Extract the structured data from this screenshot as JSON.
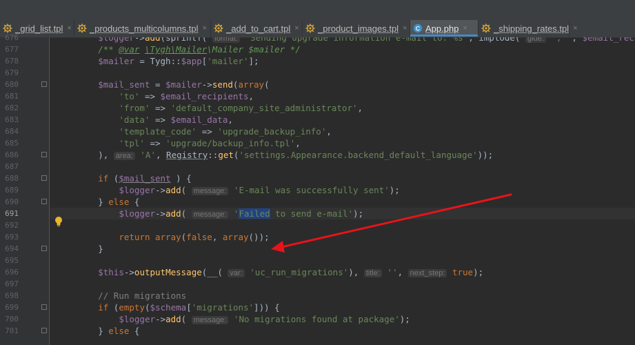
{
  "tabs": [
    {
      "label": "_grid_list.tpl",
      "icon": "smarty-template-icon",
      "active": false
    },
    {
      "label": "_products_multicolumns.tpl",
      "icon": "smarty-template-icon",
      "active": false
    },
    {
      "label": "_add_to_cart.tpl",
      "icon": "smarty-template-icon",
      "active": false
    },
    {
      "label": "_product_images.tpl",
      "icon": "smarty-template-icon",
      "active": false
    },
    {
      "label": "App.php",
      "icon": "php-class-icon",
      "active": true
    },
    {
      "label": "_shipping_rates.tpl",
      "icon": "smarty-template-icon",
      "active": false
    }
  ],
  "close_glyph": "×",
  "current_line": "691",
  "lines": [
    {
      "num": "676",
      "segments": [
        [
          "",
          "        "
        ],
        [
          "v",
          "$logger"
        ],
        [
          "",
          "->"
        ],
        [
          "f",
          "add"
        ],
        [
          "",
          "(sprintf( "
        ],
        [
          "hint",
          "format:"
        ],
        [
          "s",
          " 'Sending upgrade information e-mail to: %s'"
        ],
        [
          "",
          ", implode( "
        ],
        [
          "hint",
          "glue:"
        ],
        [
          "s",
          " ', '"
        ],
        [
          "",
          ", "
        ],
        [
          "v",
          "$email_recipients"
        ]
      ]
    },
    {
      "num": "677",
      "segments": [
        [
          "",
          "        "
        ],
        [
          "c",
          "/** "
        ],
        [
          "c u",
          "@var"
        ],
        [
          "c",
          " "
        ],
        [
          "c u",
          "\\Tygh\\Mailer"
        ],
        [
          "c",
          "\\Mailer "
        ],
        [
          "c",
          "$mailer"
        ],
        [
          "c",
          " */"
        ]
      ]
    },
    {
      "num": "678",
      "segments": [
        [
          "",
          "        "
        ],
        [
          "v",
          "$mailer"
        ],
        [
          "",
          " = Tygh::"
        ],
        [
          "v",
          "$app"
        ],
        [
          "",
          "["
        ],
        [
          "s",
          "'mailer'"
        ],
        [
          "",
          "];"
        ]
      ]
    },
    {
      "num": "679",
      "segments": []
    },
    {
      "num": "680",
      "segments": [
        [
          "",
          "        "
        ],
        [
          "v",
          "$mail_sent"
        ],
        [
          "",
          " = "
        ],
        [
          "v",
          "$mailer"
        ],
        [
          "",
          "->"
        ],
        [
          "f",
          "send"
        ],
        [
          "",
          "("
        ],
        [
          "k",
          "array"
        ],
        [
          "",
          "("
        ]
      ]
    },
    {
      "num": "681",
      "segments": [
        [
          "",
          "            "
        ],
        [
          "s",
          "'to'"
        ],
        [
          "",
          " => "
        ],
        [
          "v",
          "$email_recipients"
        ],
        [
          "",
          ","
        ]
      ]
    },
    {
      "num": "682",
      "segments": [
        [
          "",
          "            "
        ],
        [
          "s",
          "'from'"
        ],
        [
          "",
          " => "
        ],
        [
          "s",
          "'default_company_site_administrator'"
        ],
        [
          "",
          ","
        ]
      ]
    },
    {
      "num": "683",
      "segments": [
        [
          "",
          "            "
        ],
        [
          "s",
          "'data'"
        ],
        [
          "",
          " => "
        ],
        [
          "v",
          "$email_data"
        ],
        [
          "",
          ","
        ]
      ]
    },
    {
      "num": "684",
      "segments": [
        [
          "",
          "            "
        ],
        [
          "s",
          "'template_code'"
        ],
        [
          "",
          " => "
        ],
        [
          "s",
          "'upgrade_backup_info'"
        ],
        [
          "",
          ","
        ]
      ]
    },
    {
      "num": "685",
      "segments": [
        [
          "",
          "            "
        ],
        [
          "s",
          "'tpl'"
        ],
        [
          "",
          " => "
        ],
        [
          "s",
          "'upgrade/backup_info.tpl'"
        ],
        [
          "",
          ","
        ]
      ]
    },
    {
      "num": "686",
      "segments": [
        [
          "",
          "        ), "
        ],
        [
          "hint",
          "area:"
        ],
        [
          "s",
          " 'A'"
        ],
        [
          "",
          ", "
        ],
        [
          "u",
          "Registry"
        ],
        [
          "",
          "::"
        ],
        [
          "f",
          "get"
        ],
        [
          "",
          "("
        ],
        [
          "s",
          "'settings.Appearance.backend_default_language'"
        ],
        [
          "",
          "));"
        ]
      ]
    },
    {
      "num": "687",
      "segments": []
    },
    {
      "num": "688",
      "segments": [
        [
          "",
          "        "
        ],
        [
          "k",
          "if"
        ],
        [
          "",
          " ("
        ],
        [
          "v u",
          "$mail_sent"
        ],
        [
          "",
          " ) {"
        ]
      ]
    },
    {
      "num": "689",
      "segments": [
        [
          "",
          "            "
        ],
        [
          "v",
          "$logger"
        ],
        [
          "",
          "->"
        ],
        [
          "f",
          "add"
        ],
        [
          "",
          "( "
        ],
        [
          "hint",
          "message:"
        ],
        [
          "s",
          " 'E-mail was successfully sent'"
        ],
        [
          "",
          ");"
        ]
      ]
    },
    {
      "num": "690",
      "segments": [
        [
          "",
          "        } "
        ],
        [
          "k",
          "else"
        ],
        [
          "",
          " {"
        ]
      ]
    },
    {
      "num": "691",
      "segments": [
        [
          "",
          "            "
        ],
        [
          "v",
          "$logger"
        ],
        [
          "",
          "->"
        ],
        [
          "f",
          "add"
        ],
        [
          "",
          "( "
        ],
        [
          "hint",
          "message:"
        ],
        [
          "s",
          " '"
        ],
        [
          "s sel",
          "Failed"
        ],
        [
          "s",
          " to send e-mail'"
        ],
        [
          "",
          ");"
        ]
      ]
    },
    {
      "num": "692",
      "segments": []
    },
    {
      "num": "693",
      "segments": [
        [
          "",
          "            "
        ],
        [
          "k",
          "return"
        ],
        [
          "",
          " "
        ],
        [
          "k",
          "array"
        ],
        [
          "",
          "("
        ],
        [
          "k",
          "false"
        ],
        [
          "",
          ", "
        ],
        [
          "k",
          "array"
        ],
        [
          "",
          "());"
        ]
      ]
    },
    {
      "num": "694",
      "segments": [
        [
          "",
          "        }"
        ]
      ]
    },
    {
      "num": "695",
      "segments": []
    },
    {
      "num": "696",
      "segments": [
        [
          "",
          "        "
        ],
        [
          "v",
          "$this"
        ],
        [
          "",
          "->"
        ],
        [
          "f",
          "outputMessage"
        ],
        [
          "",
          "(__( "
        ],
        [
          "hint",
          "var:"
        ],
        [
          "s",
          " 'uc_run_migrations'"
        ],
        [
          "",
          "), "
        ],
        [
          "hint",
          "title:"
        ],
        [
          "s",
          " ''"
        ],
        [
          "",
          ", "
        ],
        [
          "hint",
          "next_step:"
        ],
        [
          "k",
          " true"
        ],
        [
          "",
          ");"
        ]
      ]
    },
    {
      "num": "697",
      "segments": []
    },
    {
      "num": "698",
      "segments": [
        [
          "",
          "        "
        ],
        [
          "cg",
          "// Run migrations"
        ]
      ]
    },
    {
      "num": "699",
      "segments": [
        [
          "",
          "        "
        ],
        [
          "k",
          "if"
        ],
        [
          "",
          " ("
        ],
        [
          "k",
          "empty"
        ],
        [
          "",
          "("
        ],
        [
          "v",
          "$schema"
        ],
        [
          "",
          "["
        ],
        [
          "s",
          "'migrations'"
        ],
        [
          "",
          "])) {"
        ]
      ]
    },
    {
      "num": "700",
      "segments": [
        [
          "",
          "            "
        ],
        [
          "v",
          "$logger"
        ],
        [
          "",
          "->"
        ],
        [
          "f",
          "add"
        ],
        [
          "",
          "( "
        ],
        [
          "hint",
          "message:"
        ],
        [
          "s",
          " 'No migrations found at package'"
        ],
        [
          "",
          ");"
        ]
      ]
    },
    {
      "num": "701",
      "segments": [
        [
          "",
          "        } "
        ],
        [
          "k",
          "else"
        ],
        [
          "",
          " {"
        ]
      ]
    }
  ],
  "colors": {
    "arrow": "#e8131a",
    "accent_tab": "#4a88c7",
    "bulb": "#e8b62c"
  }
}
